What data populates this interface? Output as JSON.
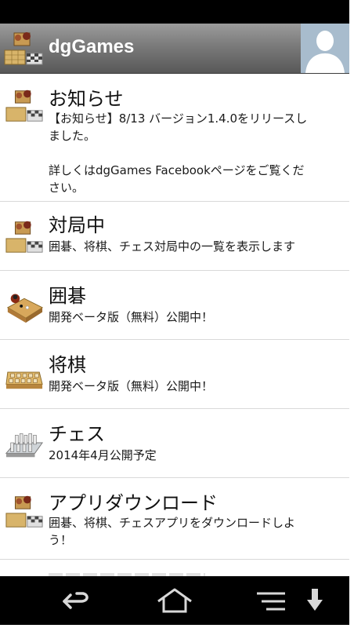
{
  "app": {
    "title": "dgGames"
  },
  "items": [
    {
      "title": "お知らせ",
      "desc_lines": [
        "【お知らせ】8/13 バージョン1.4.0をリリースし",
        "ました。",
        "",
        "詳しくはdgGames Facebookページをご覧くだ",
        "さい。"
      ],
      "icon": "board-games-icon"
    },
    {
      "title": "対局中",
      "desc_lines": [
        "囲碁、将棋、チェス対局中の一覧を表示します"
      ],
      "icon": "board-games-icon"
    },
    {
      "title": "囲碁",
      "desc_lines": [
        "開発ベータ版（無料）公開中！"
      ],
      "icon": "go-board-icon"
    },
    {
      "title": "将棋",
      "desc_lines": [
        "開発ベータ版（無料）公開中！"
      ],
      "icon": "shogi-board-icon"
    },
    {
      "title": "チェス",
      "desc_lines": [
        "2014年4月公開予定"
      ],
      "icon": "chess-board-icon"
    },
    {
      "title": "アプリダウンロード",
      "desc_lines": [
        "囲碁、将棋、チェスアプリをダウンロードしよ",
        "う！"
      ],
      "icon": "board-games-icon"
    }
  ],
  "navbar": {
    "icons": [
      "back-icon",
      "home-icon",
      "menu-icon",
      "download-icon"
    ]
  }
}
